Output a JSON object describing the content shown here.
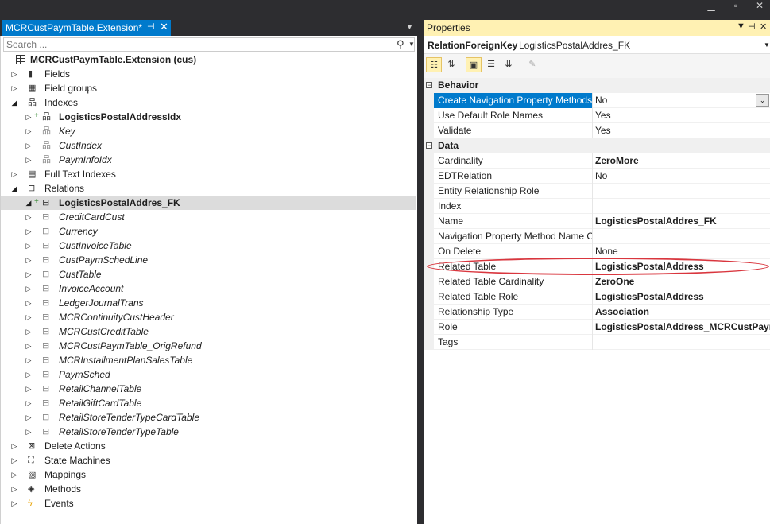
{
  "document_tab": {
    "title": "MCRCustPaymTable.Extension*",
    "pin": "⊣",
    "close": "✕"
  },
  "search": {
    "placeholder": "Search ..."
  },
  "tree": {
    "root": "MCRCustPaymTable.Extension (cus)",
    "nodes": [
      {
        "label": "Fields",
        "indent": 1,
        "expand": "closed",
        "icon": "field-icon"
      },
      {
        "label": "Field groups",
        "indent": 1,
        "expand": "closed",
        "icon": "field-group-icon"
      },
      {
        "label": "Indexes",
        "indent": 1,
        "expand": "open",
        "icon": "index-icon"
      },
      {
        "label": "LogisticsPostalAddressIdx",
        "indent": 2,
        "expand": "closed",
        "icon": "index-icon",
        "bold": true,
        "added": true
      },
      {
        "label": "Key",
        "indent": 2,
        "expand": "closed",
        "icon": "index-icon",
        "italic": true,
        "gray": true
      },
      {
        "label": "CustIndex",
        "indent": 2,
        "expand": "closed",
        "icon": "index-icon",
        "italic": true,
        "gray": true
      },
      {
        "label": "PaymInfoIdx",
        "indent": 2,
        "expand": "closed",
        "icon": "index-icon",
        "italic": true,
        "gray": true
      },
      {
        "label": "Full Text Indexes",
        "indent": 1,
        "expand": "closed",
        "icon": "full-text-index-icon"
      },
      {
        "label": "Relations",
        "indent": 1,
        "expand": "open",
        "icon": "relation-icon"
      },
      {
        "label": "LogisticsPostalAddres_FK",
        "indent": 2,
        "expand": "open",
        "icon": "relation-icon",
        "bold": true,
        "added": true,
        "selected": true
      },
      {
        "label": "CreditCardCust",
        "indent": 2,
        "expand": "closed",
        "icon": "relation-icon",
        "italic": true,
        "gray": true
      },
      {
        "label": "Currency",
        "indent": 2,
        "expand": "closed",
        "icon": "relation-icon",
        "italic": true,
        "gray": true
      },
      {
        "label": "CustInvoiceTable",
        "indent": 2,
        "expand": "closed",
        "icon": "relation-icon",
        "italic": true,
        "gray": true
      },
      {
        "label": "CustPaymSchedLine",
        "indent": 2,
        "expand": "closed",
        "icon": "relation-icon",
        "italic": true,
        "gray": true
      },
      {
        "label": "CustTable",
        "indent": 2,
        "expand": "closed",
        "icon": "relation-icon",
        "italic": true,
        "gray": true
      },
      {
        "label": "InvoiceAccount",
        "indent": 2,
        "expand": "closed",
        "icon": "relation-icon",
        "italic": true,
        "gray": true
      },
      {
        "label": "LedgerJournalTrans",
        "indent": 2,
        "expand": "closed",
        "icon": "relation-icon",
        "italic": true,
        "gray": true
      },
      {
        "label": "MCRContinuityCustHeader",
        "indent": 2,
        "expand": "closed",
        "icon": "relation-icon",
        "italic": true,
        "gray": true
      },
      {
        "label": "MCRCustCreditTable",
        "indent": 2,
        "expand": "closed",
        "icon": "relation-icon",
        "italic": true,
        "gray": true
      },
      {
        "label": "MCRCustPaymTable_OrigRefund",
        "indent": 2,
        "expand": "closed",
        "icon": "relation-icon",
        "italic": true,
        "gray": true
      },
      {
        "label": "MCRInstallmentPlanSalesTable",
        "indent": 2,
        "expand": "closed",
        "icon": "relation-icon",
        "italic": true,
        "gray": true
      },
      {
        "label": "PaymSched",
        "indent": 2,
        "expand": "closed",
        "icon": "relation-icon",
        "italic": true,
        "gray": true
      },
      {
        "label": "RetailChannelTable",
        "indent": 2,
        "expand": "closed",
        "icon": "relation-icon",
        "italic": true,
        "gray": true
      },
      {
        "label": "RetailGiftCardTable",
        "indent": 2,
        "expand": "closed",
        "icon": "relation-icon",
        "italic": true,
        "gray": true
      },
      {
        "label": "RetailStoreTenderTypeCardTable",
        "indent": 2,
        "expand": "closed",
        "icon": "relation-icon",
        "italic": true,
        "gray": true
      },
      {
        "label": "RetailStoreTenderTypeTable",
        "indent": 2,
        "expand": "closed",
        "icon": "relation-icon",
        "italic": true,
        "gray": true
      },
      {
        "label": "Delete Actions",
        "indent": 1,
        "expand": "closed",
        "icon": "delete-action-icon"
      },
      {
        "label": "State Machines",
        "indent": 1,
        "expand": "closed",
        "icon": "state-machine-icon"
      },
      {
        "label": "Mappings",
        "indent": 1,
        "expand": "closed",
        "icon": "mapping-icon"
      },
      {
        "label": "Methods",
        "indent": 1,
        "expand": "closed",
        "icon": "method-icon"
      },
      {
        "label": "Events",
        "indent": 1,
        "expand": "closed",
        "icon": "event-icon"
      }
    ]
  },
  "properties": {
    "title": "Properties",
    "object_type": "RelationForeignKey",
    "object_name": "LogisticsPostalAddres_FK",
    "categories": [
      {
        "name": "Behavior",
        "rows": [
          {
            "name": "Create Navigation Property Methods",
            "value": "No",
            "selected": true,
            "dropdown": true
          },
          {
            "name": "Use Default Role Names",
            "value": "Yes"
          },
          {
            "name": "Validate",
            "value": "Yes"
          }
        ]
      },
      {
        "name": "Data",
        "rows": [
          {
            "name": "Cardinality",
            "value": "ZeroMore",
            "bold": true
          },
          {
            "name": "EDTRelation",
            "value": "No"
          },
          {
            "name": "Entity Relationship Role",
            "value": ""
          },
          {
            "name": "Index",
            "value": ""
          },
          {
            "name": "Name",
            "value": "LogisticsPostalAddres_FK",
            "bold": true
          },
          {
            "name": "Navigation Property Method Name Override",
            "value": ""
          },
          {
            "name": "On Delete",
            "value": "None"
          },
          {
            "name": "Related Table",
            "value": "LogisticsPostalAddress",
            "bold": true
          },
          {
            "name": "Related Table Cardinality",
            "value": "ZeroOne",
            "bold": true
          },
          {
            "name": "Related Table Role",
            "value": "LogisticsPostalAddress",
            "bold": true
          },
          {
            "name": "Relationship Type",
            "value": "Association",
            "bold": true
          },
          {
            "name": "Role",
            "value": "LogisticsPostalAddress_MCRCustPaymTable",
            "bold": true
          },
          {
            "name": "Tags",
            "value": ""
          }
        ]
      }
    ]
  },
  "colors": {
    "accent": "#007acc",
    "header_active": "#fff1b3",
    "highlight": "#d9363e"
  }
}
